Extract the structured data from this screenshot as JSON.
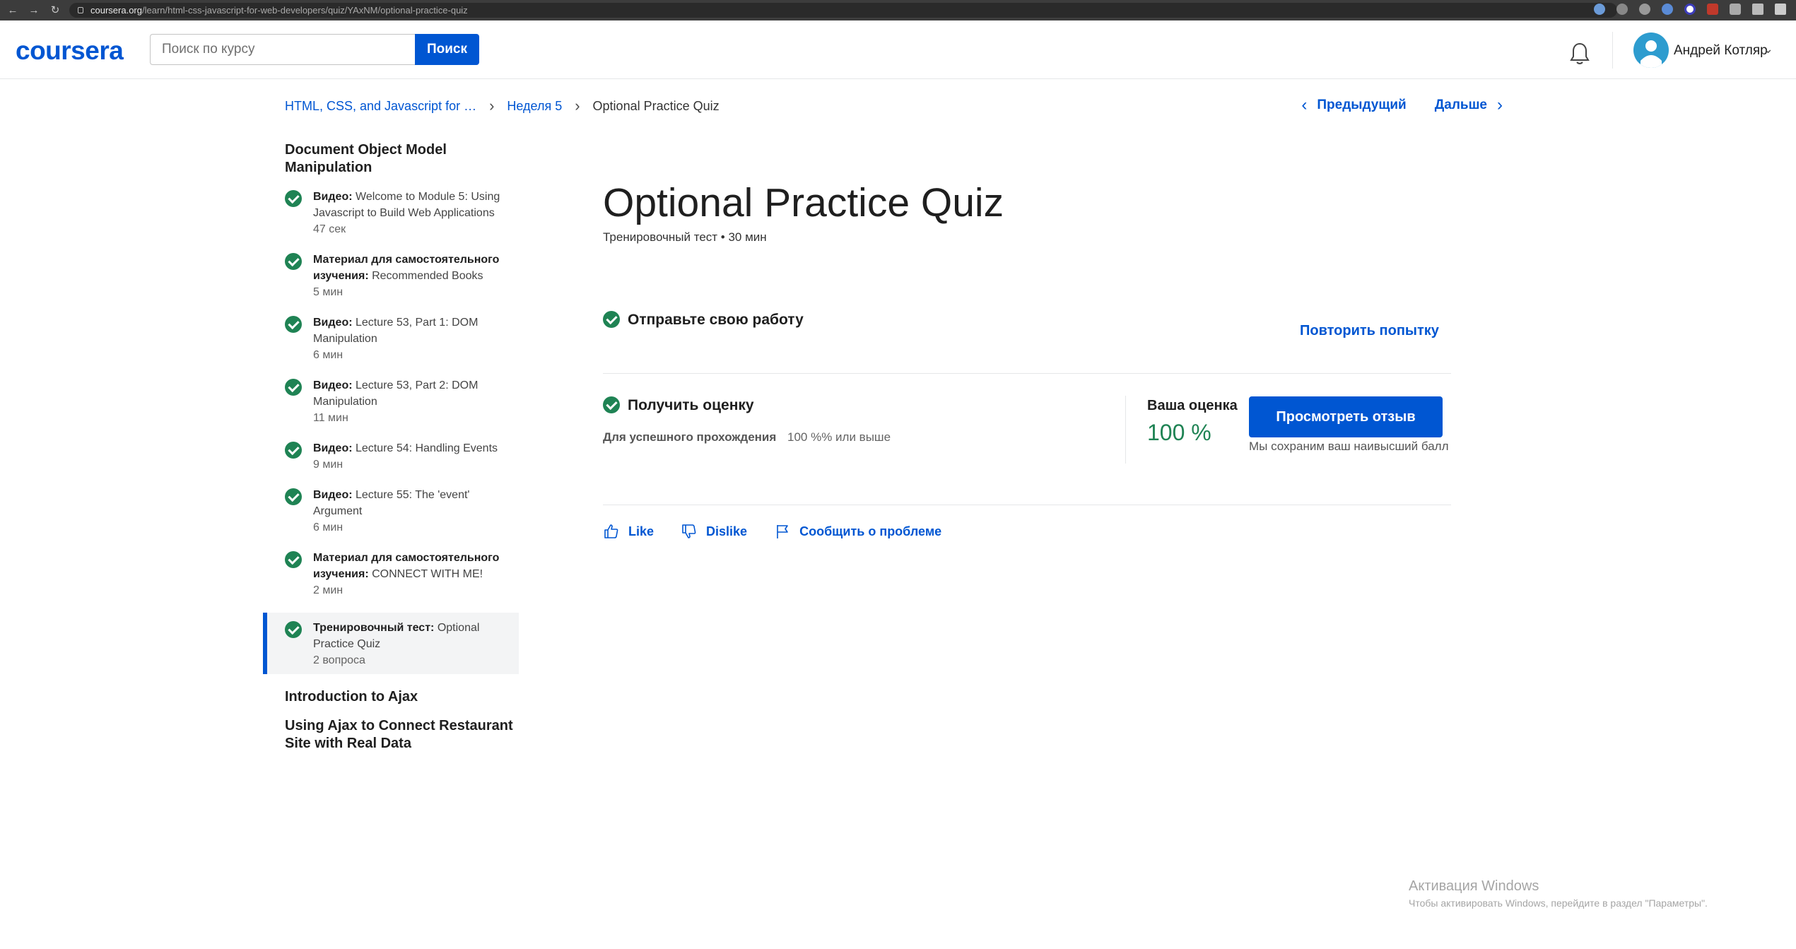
{
  "browser": {
    "url_domain": "coursera.org",
    "url_path": "/learn/html-css-javascript-for-web-developers/quiz/YAxNM/optional-practice-quiz"
  },
  "header": {
    "logo": "coursera",
    "search_placeholder": "Поиск по курсу",
    "search_button": "Поиск",
    "user_name": "Андрей Котляр"
  },
  "breadcrumb": {
    "course": "HTML, CSS, and Javascript for …",
    "week": "Неделя 5",
    "current": "Optional Practice Quiz"
  },
  "pager": {
    "prev": "Предыдущий",
    "next": "Дальше"
  },
  "sidebar": {
    "module_title": "Document Object Model Manipulation",
    "items": [
      {
        "kind": "Видео:",
        "title": "Welcome to Module 5: Using Javascript to Build Web Applications",
        "duration": "47 сек"
      },
      {
        "kind": "Материал для самостоятельного изучения:",
        "title": "Recommended Books",
        "duration": "5 мин"
      },
      {
        "kind": "Видео:",
        "title": "Lecture 53, Part 1: DOM Manipulation",
        "duration": "6 мин"
      },
      {
        "kind": "Видео:",
        "title": "Lecture 53, Part 2: DOM Manipulation",
        "duration": "11 мин"
      },
      {
        "kind": "Видео:",
        "title": "Lecture 54: Handling Events",
        "duration": "9 мин"
      },
      {
        "kind": "Видео:",
        "title": "Lecture 55: The 'event' Argument",
        "duration": "6 мин"
      },
      {
        "kind": "Материал для самостоятельного изучения:",
        "title": "CONNECT WITH ME!",
        "duration": "2 мин"
      },
      {
        "kind": "Тренировочный тест:",
        "title": "Optional Practice Quiz",
        "duration": "2 вопроса"
      }
    ],
    "other_modules": [
      "Introduction to Ajax",
      "Using Ajax to Connect Restaurant Site with Real Data"
    ]
  },
  "main": {
    "title": "Optional Practice Quiz",
    "meta": "Тренировочный тест • 30 мин",
    "step1_label": "Отправьте свою работу",
    "retry": "Повторить попытку",
    "step2_label": "Получить оценку",
    "pass_label": "Для успешного прохождения",
    "pass_value": "100 %% или выше",
    "grade_label": "Ваша оценка",
    "grade_value": "100 %",
    "review_button": "Просмотреть отзыв",
    "save_note": "Мы сохраним ваш наивысший балл",
    "like": "Like",
    "dislike": "Dislike",
    "report": "Сообщить о проблеме"
  },
  "watermark": {
    "title": "Активация Windows",
    "subtitle": "Чтобы активировать Windows, перейдите в раздел \"Параметры\"."
  },
  "colors": {
    "accent": "#0056d2",
    "success": "#1f8354"
  }
}
